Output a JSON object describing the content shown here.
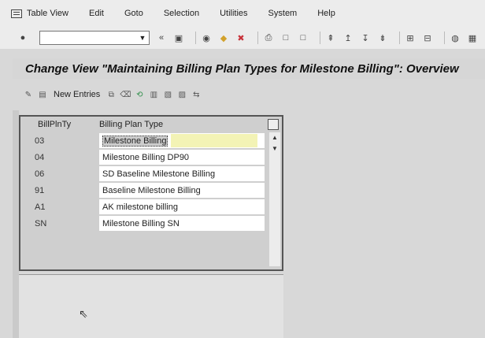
{
  "menu": {
    "items": [
      "Table View",
      "Edit",
      "Goto",
      "Selection",
      "Utilities",
      "System",
      "Help"
    ]
  },
  "toolbar": {
    "command_value": ""
  },
  "title": "Change View \"Maintaining Billing Plan Types for Milestone Billing\": Overview",
  "app_toolbar": {
    "new_entries_label": "New Entries"
  },
  "table": {
    "columns": [
      "BillPlnTy",
      "Billing Plan Type"
    ],
    "rows": [
      {
        "key": "03",
        "desc": "Milestone Billing"
      },
      {
        "key": "04",
        "desc": "Milestone Billing DP90"
      },
      {
        "key": "06",
        "desc": "SD Baseline Milestone Billing"
      },
      {
        "key": "91",
        "desc": "Baseline Milestone Billing"
      },
      {
        "key": "A1",
        "desc": "AK milestone billing"
      },
      {
        "key": "SN",
        "desc": "Milestone Billing SN"
      }
    ]
  }
}
